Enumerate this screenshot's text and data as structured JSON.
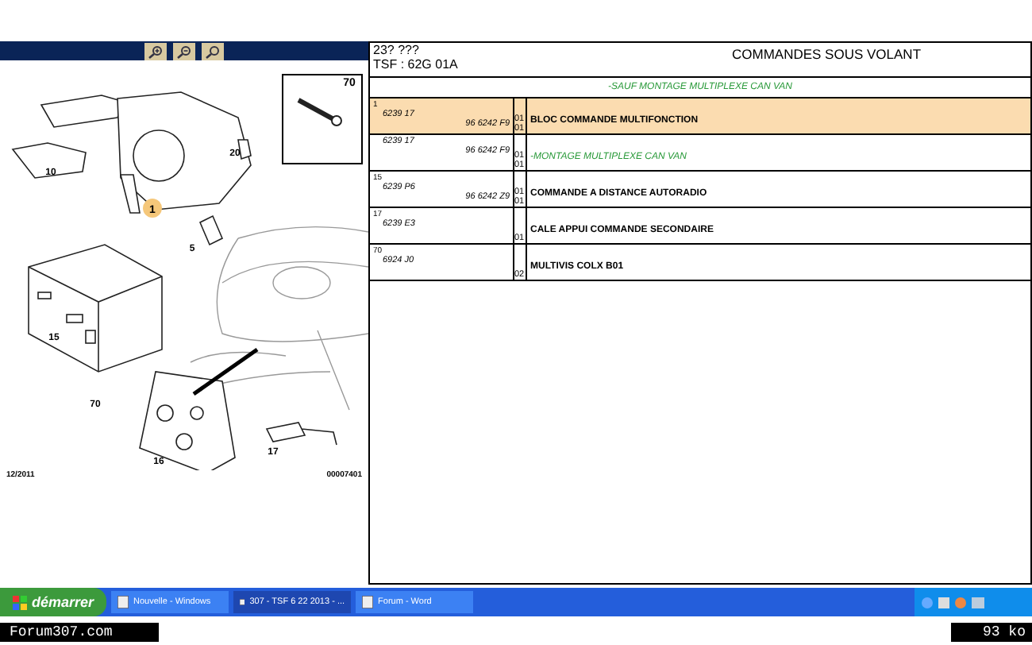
{
  "toolbar": {
    "buttons": [
      {
        "kind": "zoom-in"
      },
      {
        "kind": "zoom-out"
      },
      {
        "kind": "zoom-fit"
      }
    ]
  },
  "diagram": {
    "callouts": [
      {
        "label": "70",
        "kind": "boxed"
      },
      {
        "label": "10",
        "kind": "plain"
      },
      {
        "label": "20",
        "kind": "plain"
      },
      {
        "label": "1",
        "kind": "highlight"
      },
      {
        "label": "5",
        "kind": "plain"
      },
      {
        "label": "15",
        "kind": "plain"
      },
      {
        "label": "70",
        "kind": "plain"
      },
      {
        "label": "16",
        "kind": "plain"
      },
      {
        "label": "17",
        "kind": "plain"
      }
    ],
    "date": "12/2011",
    "code": "00007401"
  },
  "header": {
    "code": "23? ???",
    "tsf": "TSF : 62G 01A",
    "title": "COMMANDES SOUS VOLANT",
    "note": "-SAUF MONTAGE MULTIPLEXE CAN VAN"
  },
  "table": {
    "rows": [
      {
        "kind": "part",
        "selected": true,
        "ref": "1",
        "part": "6239 17",
        "sub": "96 6242 F9",
        "qty": "01",
        "qty2": "01",
        "desc": "BLOC COMMANDE MULTIFONCTION"
      },
      {
        "kind": "note",
        "selected": false,
        "part": "6239 17",
        "sub": "96 6242 F9",
        "qty": "01",
        "qty2": "01",
        "desc": "-MONTAGE MULTIPLEXE CAN VAN"
      },
      {
        "kind": "part",
        "selected": false,
        "ref": "15",
        "part": "6239 P6",
        "sub": "96 6242 Z9",
        "qty": "01",
        "qty2": "01",
        "desc": "COMMANDE A DISTANCE AUTORADIO"
      },
      {
        "kind": "part",
        "selected": false,
        "ref": "17",
        "part": "6239 E3",
        "qty": "01",
        "desc": "CALE APPUI COMMANDE SECONDAIRE"
      },
      {
        "kind": "part",
        "selected": false,
        "ref": "70",
        "part": "6924 J0",
        "qty": "02",
        "desc": "MULTIVIS COLX B01"
      }
    ]
  },
  "taskbar": {
    "start": "démarrer",
    "items": [
      {
        "label": "Nouvelle - Windows",
        "selected": false
      },
      {
        "label": "307 - TSF 6 22 2013 - ...",
        "selected": true
      },
      {
        "label": "Forum - Word",
        "selected": false
      }
    ]
  },
  "footer": {
    "site": "Forum307.com",
    "size": "93 ko"
  }
}
